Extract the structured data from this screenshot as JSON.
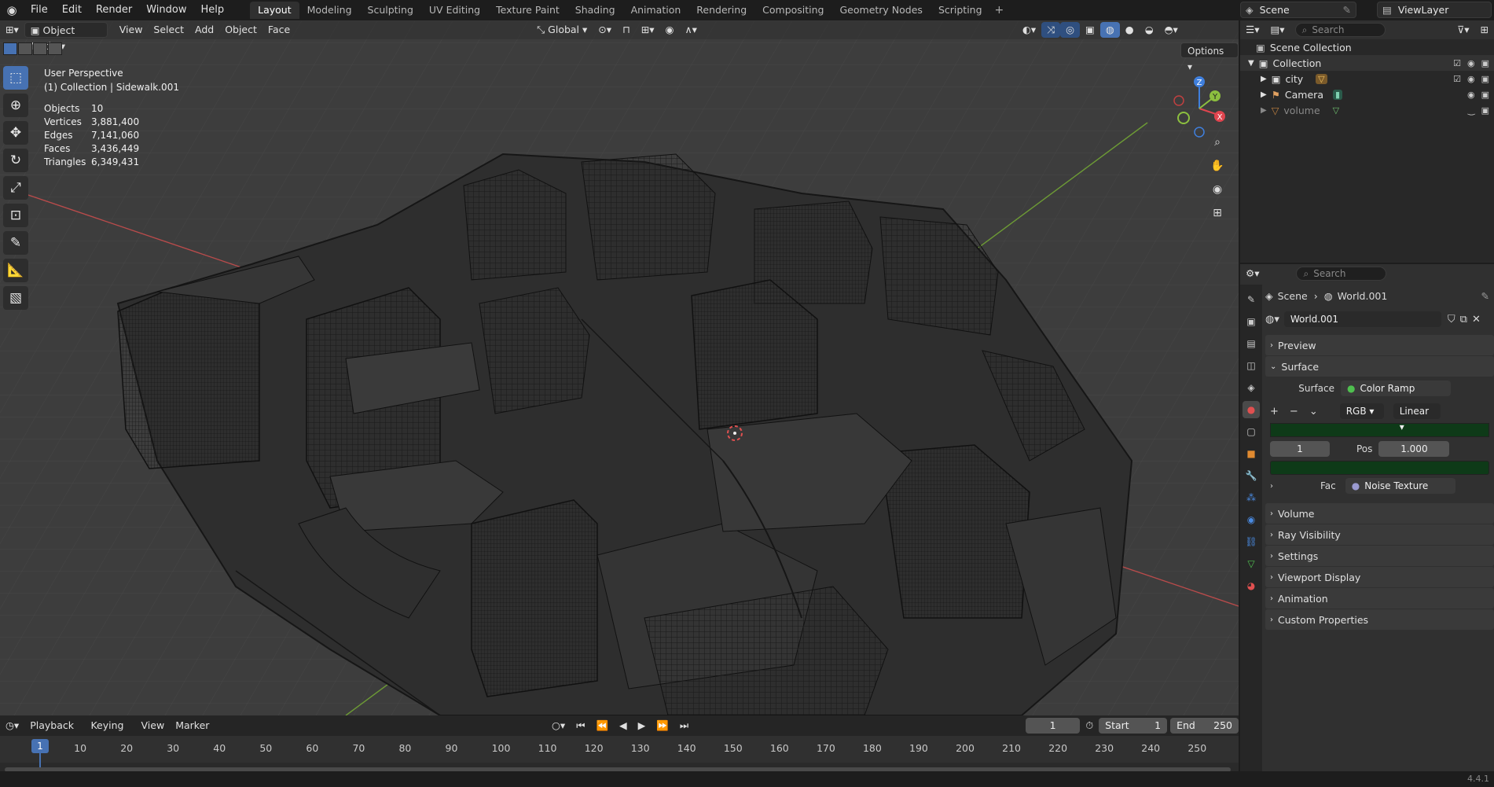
{
  "menu": {
    "items": [
      "File",
      "Edit",
      "Render",
      "Window",
      "Help"
    ]
  },
  "workspaces": [
    "Layout",
    "Modeling",
    "Sculpting",
    "UV Editing",
    "Texture Paint",
    "Shading",
    "Animation",
    "Rendering",
    "Compositing",
    "Geometry Nodes",
    "Scripting"
  ],
  "active_workspace": "Layout",
  "scene": {
    "name": "Scene",
    "view_layer": "ViewLayer"
  },
  "viewport": {
    "mode": "Object Mode",
    "menus": [
      "View",
      "Select",
      "Add",
      "Object",
      "Face"
    ],
    "orientation": "Global",
    "options_label": "Options",
    "perspective": "User Perspective",
    "context": "(1) Collection | Sidewalk.001",
    "stats": [
      {
        "label": "Objects",
        "value": "10"
      },
      {
        "label": "Vertices",
        "value": "3,881,400"
      },
      {
        "label": "Edges",
        "value": "7,141,060"
      },
      {
        "label": "Faces",
        "value": "3,436,449"
      },
      {
        "label": "Triangles",
        "value": "6,349,431"
      }
    ],
    "gizmo_axes": [
      "X",
      "Y",
      "Z"
    ]
  },
  "timeline": {
    "menus": [
      "Playback",
      "Keying",
      "View",
      "Marker"
    ],
    "current_frame": "1",
    "start_label": "Start",
    "start": "1",
    "end_label": "End",
    "end": "250",
    "ticks": [
      "1",
      "10",
      "20",
      "30",
      "40",
      "50",
      "60",
      "70",
      "80",
      "90",
      "100",
      "110",
      "120",
      "130",
      "140",
      "150",
      "160",
      "170",
      "180",
      "190",
      "200",
      "210",
      "220",
      "230",
      "240",
      "250"
    ],
    "version": "4.4.1"
  },
  "outliner": {
    "search_placeholder": "Search",
    "root": "Scene Collection",
    "collection": "Collection",
    "items": [
      "city",
      "Camera",
      "volume"
    ]
  },
  "properties": {
    "search_placeholder": "Search",
    "breadcrumb": [
      "Scene",
      "World.001"
    ],
    "world_name": "World.001",
    "panels_top": [
      "Preview",
      "Surface"
    ],
    "surface_label": "Surface",
    "surface_value": "Color Ramp",
    "color_mode": "RGB",
    "interpolation": "Linear",
    "stop_index": "1",
    "pos_label": "Pos",
    "pos_value": "1.000",
    "fac_label": "Fac",
    "fac_value": "Noise Texture",
    "panels_bottom": [
      "Volume",
      "Ray Visibility",
      "Settings",
      "Viewport Display",
      "Animation",
      "Custom Properties"
    ]
  },
  "colors": {
    "accent": "#4772b3",
    "x_axis": "#e0454f",
    "y_axis": "#8cbf3f",
    "z_axis": "#3f7fdd",
    "ramp": "#0e3a18"
  }
}
